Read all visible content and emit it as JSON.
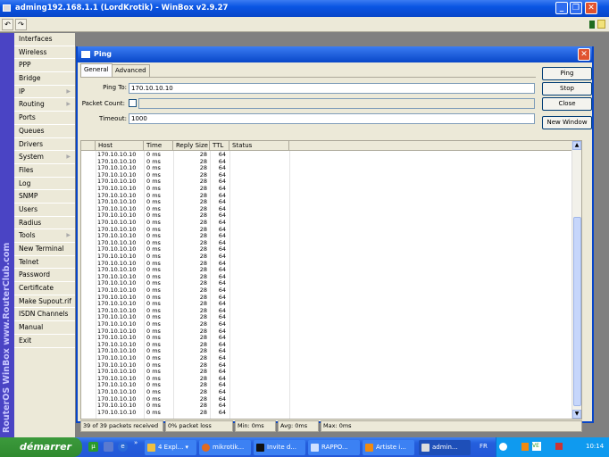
{
  "window": {
    "title": "adming192.168.1.1 (LordKrotik) - WinBox v2.9.27",
    "minimize": "_",
    "restore": "❐",
    "close": "✕"
  },
  "toolbar": {
    "undo": "↶",
    "redo": "↷"
  },
  "sidebar": {
    "brand": "RouterOS WinBox   www.RouterClub.com",
    "items": [
      {
        "label": "Interfaces"
      },
      {
        "label": "Wireless"
      },
      {
        "label": "PPP"
      },
      {
        "label": "Bridge"
      },
      {
        "label": "IP",
        "submenu": true
      },
      {
        "label": "Routing",
        "submenu": true
      },
      {
        "label": "Ports"
      },
      {
        "label": "Queues"
      },
      {
        "label": "Drivers"
      },
      {
        "label": "System",
        "submenu": true
      },
      {
        "label": "Files"
      },
      {
        "label": "Log"
      },
      {
        "label": "SNMP"
      },
      {
        "label": "Users"
      },
      {
        "label": "Radius"
      },
      {
        "label": "Tools",
        "submenu": true
      },
      {
        "label": "New Terminal"
      },
      {
        "label": "Telnet"
      },
      {
        "label": "Password"
      },
      {
        "label": "Certificate"
      },
      {
        "label": "Make Supout.rif"
      },
      {
        "label": "ISDN Channels"
      },
      {
        "label": "Manual"
      },
      {
        "label": "Exit"
      }
    ]
  },
  "ping": {
    "title": "Ping",
    "close": "✕",
    "tabs": [
      "General",
      "Advanced"
    ],
    "ping_to_label": "Ping To:",
    "ping_to": "170.10.10.10",
    "packet_count_label": "Packet Count:",
    "packet_count": "",
    "timeout_label": "Timeout:",
    "timeout": "1000",
    "buttons": {
      "ping": "Ping",
      "stop": "Stop",
      "close": "Close",
      "new_window": "New Window"
    },
    "columns": [
      "Host",
      "Time",
      "Reply Size",
      "TTL",
      "Status"
    ],
    "row": {
      "host": "170.10.10.10",
      "time": "0 ms",
      "size": "28",
      "ttl": "64",
      "status": ""
    },
    "row_count": 39,
    "status": {
      "received": "39 of 39 packets received",
      "loss": "0% packet loss",
      "min": "Min: 0ms",
      "avg": "Avg: 0ms",
      "max": "Max: 0ms"
    }
  },
  "taskbar": {
    "start": "démarrer",
    "tasks": [
      "4 Expl...",
      "mikrotik...",
      "Invite d...",
      "RAPPO...",
      "Artiste i...",
      "admin..."
    ],
    "lang": "FR",
    "clock": "10:14"
  }
}
